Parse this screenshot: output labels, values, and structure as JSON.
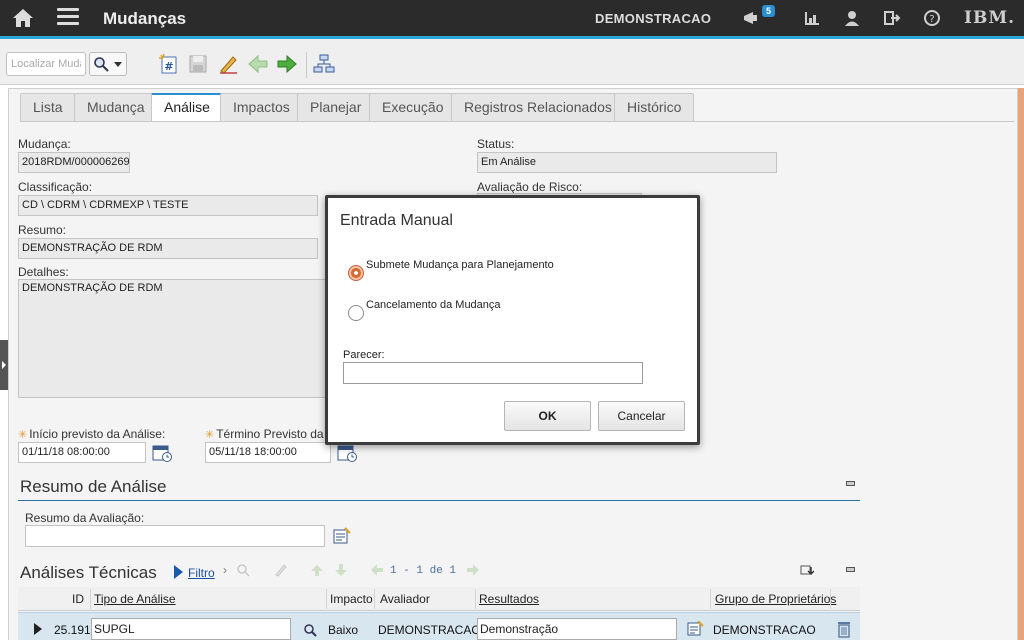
{
  "header": {
    "title": "Mudanças",
    "user": "DEMONSTRACAO",
    "notification_count": "5",
    "logo": "IBM."
  },
  "toolbar": {
    "search_placeholder": "Localizar Mudança",
    "icons": [
      "new-record-icon",
      "save-icon",
      "edit-icon",
      "previous-icon",
      "next-icon",
      "workflow-icon"
    ]
  },
  "tabs": [
    "Lista",
    "Mudança",
    "Análise",
    "Impactos",
    "Planejar",
    "Execução",
    "Registros Relacionados",
    "Histórico"
  ],
  "active_tab": "Análise",
  "form": {
    "change_label": "Mudança:",
    "change_value": "2018RDM/000006269",
    "status_label": "Status:",
    "status_value": "Em Análise",
    "classification_label": "Classificação:",
    "classification_value": "CD \\ CDRM \\ CDRMEXP \\ TESTE",
    "risk_label": "Avaliação de Risco:",
    "summary_label": "Resumo:",
    "summary_value": "DEMONSTRAÇÃO DE RDM",
    "details_label": "Detalhes:",
    "details_value": "DEMONSTRAÇÃO DE RDM",
    "start_label": "Início previsto da Análise:",
    "start_value": "01/11/18 08:00:00",
    "end_label": "Término Previsto da A",
    "end_value": "05/11/18 18:00:00"
  },
  "analysis_summary": {
    "title": "Resumo de Análise",
    "evaluation_label": "Resumo da Avaliação:",
    "evaluation_value": ""
  },
  "technical_analyses": {
    "title": "Análises Técnicas",
    "filter_label": "Filtro",
    "pagination": "1 - 1 de 1",
    "columns": [
      "ID",
      "Tipo de Análise",
      "Impacto",
      "Avaliador",
      "Resultados",
      "Grupo de Proprietários"
    ],
    "rows": [
      {
        "id": "25.191",
        "type": "SUPGL",
        "impact": "Baixo",
        "evaluator": "DEMONSTRACAO",
        "results": "Demonstração",
        "owner_group": "DEMONSTRACAO"
      }
    ]
  },
  "modal": {
    "title": "Entrada Manual",
    "option_submit": "Submete Mudança para Planejamento",
    "option_cancel": "Cancelamento da Mudança",
    "selected": "option_submit",
    "opinion_label": "Parecer:",
    "opinion_value": "",
    "ok_label": "OK",
    "cancel_label": "Cancelar"
  },
  "colors": {
    "topbar": "#2b2b2b",
    "accent": "#2aa7d6",
    "radio_selected": "#d9692f",
    "link": "#1a4fa0"
  }
}
